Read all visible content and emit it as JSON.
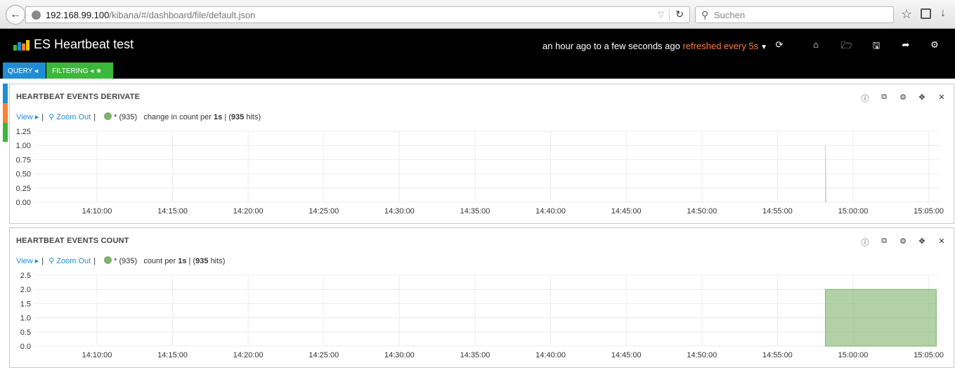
{
  "browser": {
    "url_host": "192.168.99.100",
    "url_path": "/kibana/#/dashboard/file/default.json",
    "search_placeholder": "Suchen"
  },
  "nav": {
    "title": "ES Heartbeat test",
    "time_range": "an hour ago to a few seconds ago",
    "refresh_label": "refreshed every 5s",
    "icons": [
      "refresh-icon",
      "home-icon",
      "folder-open-icon",
      "save-icon",
      "share-icon",
      "gear-icon"
    ]
  },
  "pills": {
    "query_label": "QUERY",
    "filter_label": "FILTERING"
  },
  "colors": {
    "query": "#1f8dd6",
    "filter": "#3ab83a",
    "accent_orange": "#ff7f33",
    "series": "#7eb26d"
  },
  "panels": [
    {
      "title": "HEARTBEAT EVENTS DERIVATE",
      "view_label": "View",
      "zoom_label": "Zoom Out",
      "legend_query": "* (935)",
      "legend_desc_pre": "change in count per",
      "legend_interval": "1s",
      "legend_hits_count": "935",
      "legend_hits_word": "hits",
      "chart_data": {
        "type": "line",
        "title": "HEARTBEAT EVENTS DERIVATE",
        "yticks": [
          "1.25",
          "1.00",
          "0.75",
          "0.50",
          "0.25",
          "0.00"
        ],
        "ylim": [
          0,
          1.25
        ],
        "xticks": [
          "14:10:00",
          "14:15:00",
          "14:20:00",
          "14:25:00",
          "14:30:00",
          "14:35:00",
          "14:40:00",
          "14:45:00",
          "14:50:00",
          "14:55:00",
          "15:00:00",
          "15:05:00"
        ],
        "series": [
          {
            "name": "* (935)",
            "x_start": "14:58:10",
            "x_end": "15:05:30",
            "values": [
              0,
              1,
              0
            ]
          }
        ]
      }
    },
    {
      "title": "HEARTBEAT EVENTS COUNT",
      "view_label": "View",
      "zoom_label": "Zoom Out",
      "legend_query": "* (935)",
      "legend_desc_pre": "count per",
      "legend_interval": "1s",
      "legend_hits_count": "935",
      "legend_hits_word": "hits",
      "chart_data": {
        "type": "area",
        "title": "HEARTBEAT EVENTS COUNT",
        "yticks": [
          "2.5",
          "2.0",
          "1.5",
          "1.0",
          "0.5",
          "0.0"
        ],
        "ylim": [
          0,
          2.5
        ],
        "xticks": [
          "14:10:00",
          "14:15:00",
          "14:20:00",
          "14:25:00",
          "14:30:00",
          "14:35:00",
          "14:40:00",
          "14:45:00",
          "14:50:00",
          "14:55:00",
          "15:00:00",
          "15:05:00"
        ],
        "series": [
          {
            "name": "* (935)",
            "x_start": "14:58:10",
            "x_end": "15:05:30",
            "value": 2
          }
        ]
      }
    }
  ]
}
